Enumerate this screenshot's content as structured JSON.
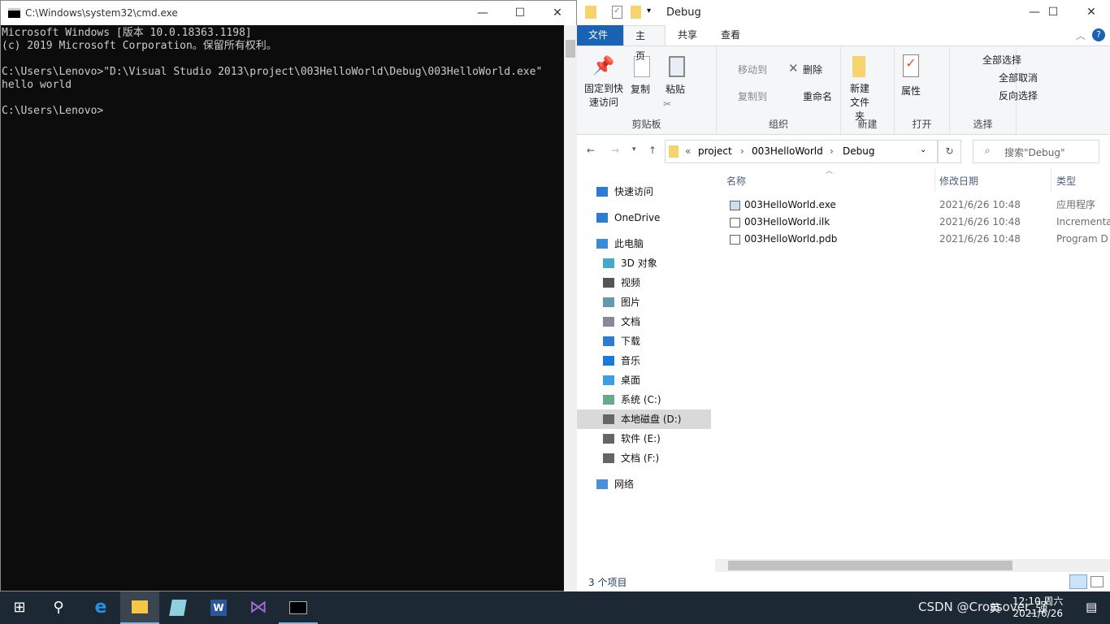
{
  "cmd": {
    "title": "C:\\Windows\\system32\\cmd.exe",
    "lines": [
      "Microsoft Windows [版本 10.0.18363.1198]",
      "(c) 2019 Microsoft Corporation。保留所有权利。",
      "",
      "C:\\Users\\Lenovo>\"D:\\Visual Studio 2013\\project\\003HelloWorld\\Debug\\003HelloWorld.exe\"",
      "hello world",
      "",
      "C:\\Users\\Lenovo>"
    ]
  },
  "explorer": {
    "title": "Debug",
    "tabs": [
      "文件",
      "主页",
      "共享",
      "查看"
    ],
    "ribbon": {
      "clipboard": {
        "label": "剪贴板",
        "pin": "固定到快速访问",
        "copy": "复制",
        "paste": "粘贴"
      },
      "organize": {
        "label": "组织",
        "move_to": "移动到",
        "copy_to": "复制到",
        "delete": "删除",
        "rename": "重命名"
      },
      "new": {
        "label": "新建",
        "new_folder": "新建文件夹"
      },
      "open": {
        "label": "打开",
        "properties": "属性"
      },
      "select": {
        "label": "选择",
        "select_all": "全部选择",
        "select_none": "全部取消",
        "invert": "反向选择"
      }
    },
    "breadcrumb": [
      "project",
      "003HelloWorld",
      "Debug"
    ],
    "search_placeholder": "搜索\"Debug\"",
    "nav": [
      "快速访问",
      "OneDrive",
      "此电脑",
      "3D 对象",
      "视频",
      "图片",
      "文档",
      "下载",
      "音乐",
      "桌面",
      "系统 (C:)",
      "本地磁盘 (D:)",
      "软件 (E:)",
      "文档 (F:)",
      "网络"
    ],
    "columns": [
      "名称",
      "修改日期",
      "类型"
    ],
    "files": [
      {
        "name": "003HelloWorld.exe",
        "date": "2021/6/26 10:48",
        "type": "应用程序"
      },
      {
        "name": "003HelloWorld.ilk",
        "date": "2021/6/26 10:48",
        "type": "Incrementa"
      },
      {
        "name": "003HelloWorld.pdb",
        "date": "2021/6/26 10:48",
        "type": "Program D"
      }
    ],
    "status": "3 个项目"
  },
  "taskbar": {
    "time": "12:10 周六",
    "date": "2021/6/26",
    "ime": "英",
    "watermark": "CSDN @Crossover_强"
  }
}
